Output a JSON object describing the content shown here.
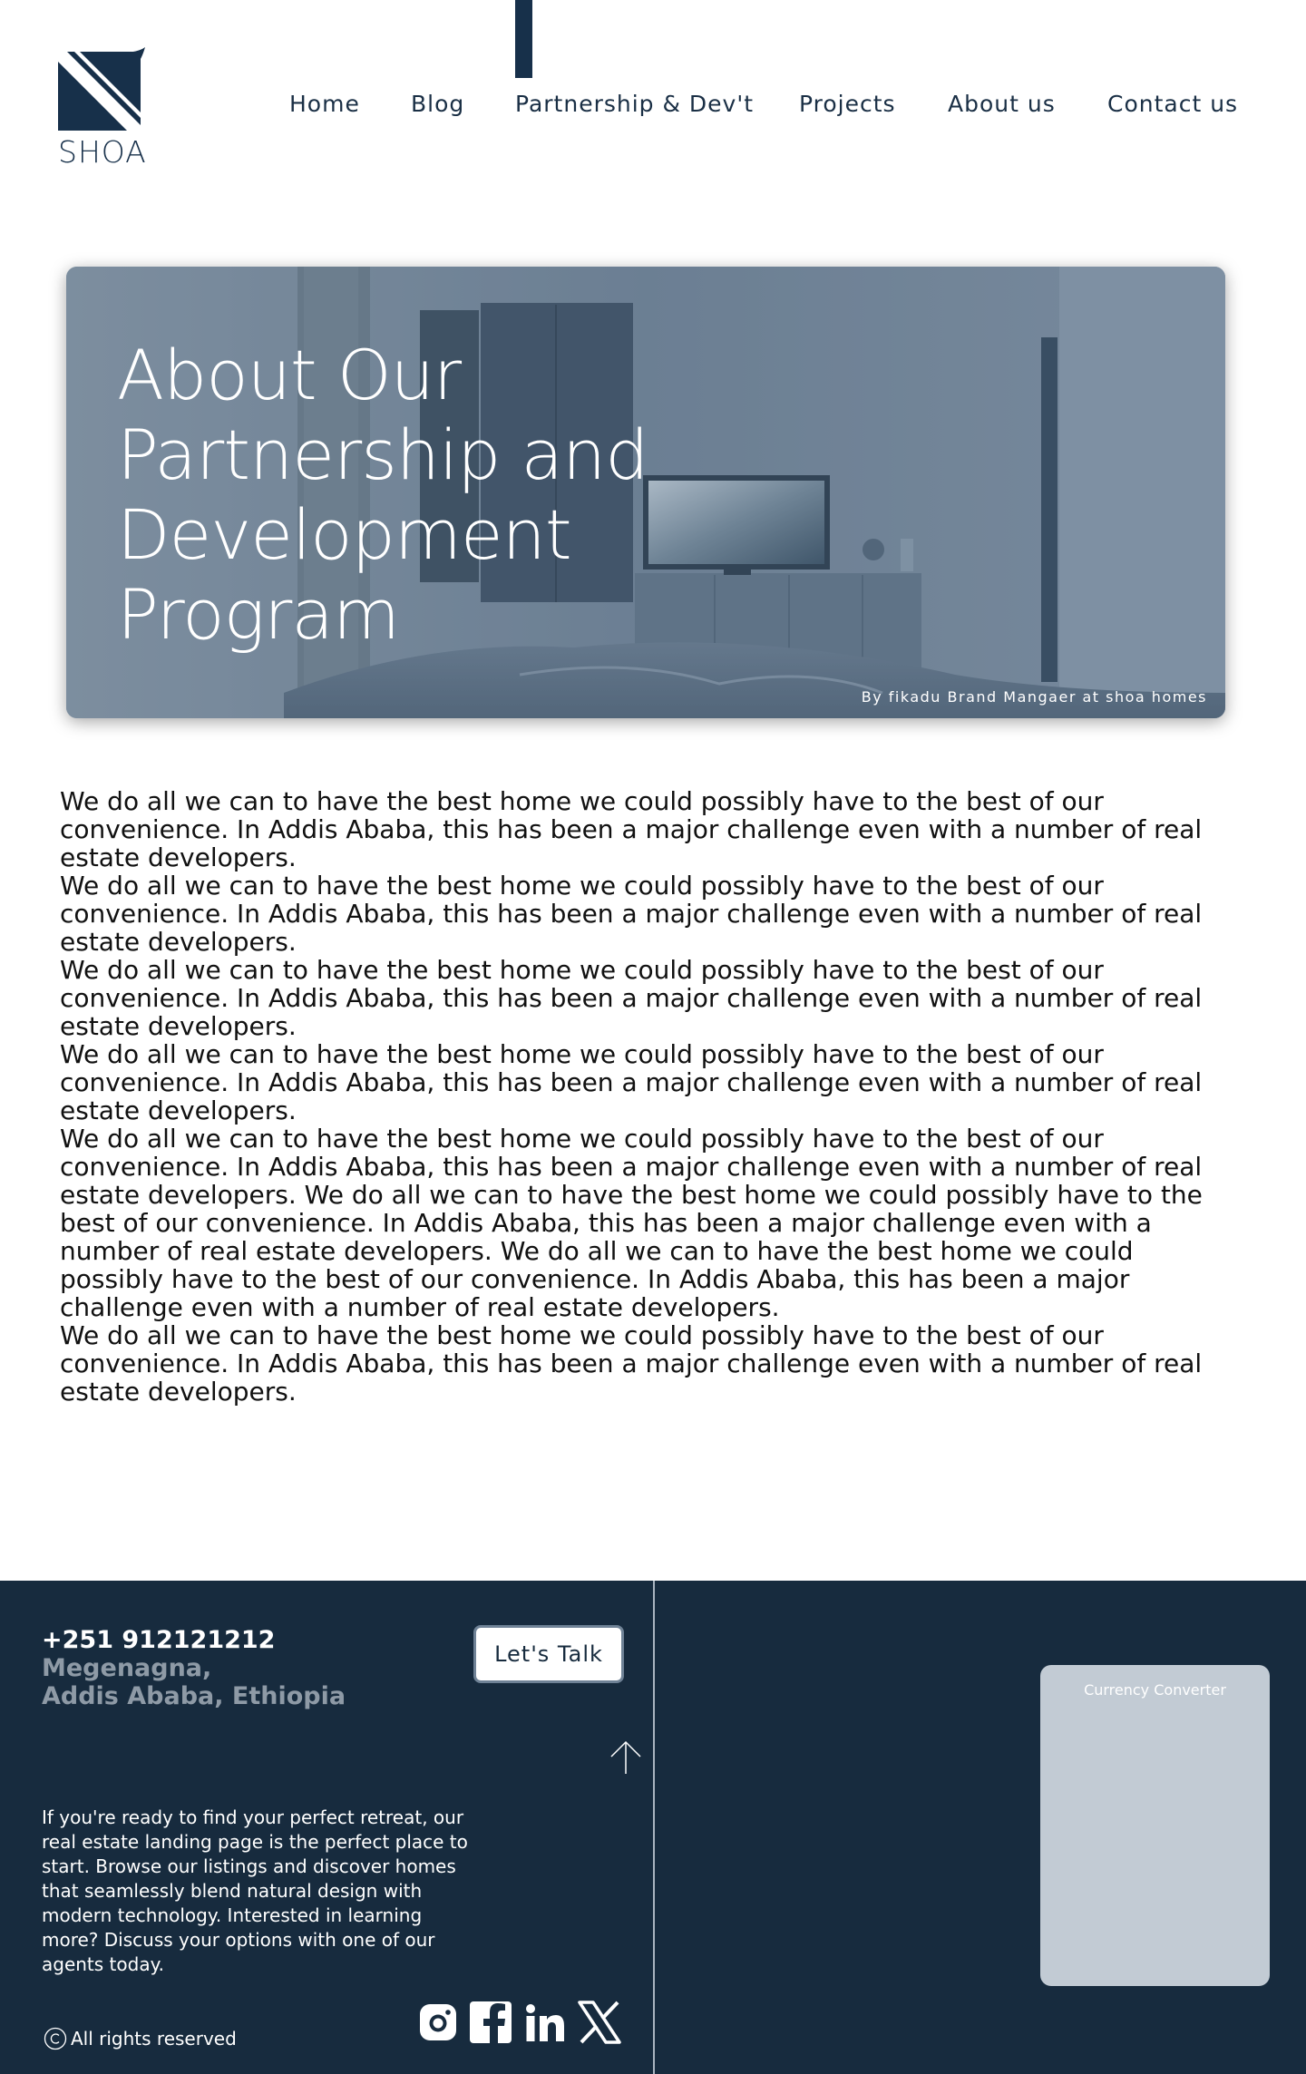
{
  "brand": {
    "logo_text": "SHOA",
    "primary_color": "#17304a",
    "footer_color": "#172b3e"
  },
  "nav": {
    "items": [
      {
        "label": "Home"
      },
      {
        "label": "Blog"
      },
      {
        "label": "Partnership & Dev't",
        "active": true
      },
      {
        "label": "Projects"
      },
      {
        "label": "About us"
      },
      {
        "label": "Contact us"
      }
    ]
  },
  "hero": {
    "title": "About Our Partnership and Development Program",
    "caption": "By fikadu Brand Mangaer at shoa homes"
  },
  "content": {
    "paragraphs": [
      "We do all we can to have the best home we could possibly have to the best of our convenience. In Addis Ababa, this has been a major challenge even with a number of real estate developers.",
      "We do all we can to have the best home we could possibly have to the best of our convenience. In Addis Ababa, this has been a major challenge even with a number of real estate developers.",
      "We do all we can to have the best home we could possibly have to the best of our convenience. In Addis Ababa, this has been a major challenge even with a number of real estate developers.",
      "We do all we can to have the best home we could possibly have to the best of our convenience. In Addis Ababa, this has been a major challenge even with a number of real estate developers.",
      "We do all we can to have the best home we could possibly have to the best of our convenience. In Addis Ababa, this has been a major challenge even with a number of real estate developers. We do all we can to have the best home we could possibly have to the best of our convenience. In Addis Ababa, this has been a major challenge even with a number of real estate developers. We do all we can to have the best home we could possibly have to the best of our convenience. In Addis Ababa, this has been a major challenge even with a number of real estate developers.",
      "We do all we can to have the best home we could possibly have to the best of our convenience. In Addis Ababa, this has been a major challenge even with a number of real estate developers."
    ]
  },
  "footer": {
    "phone": "+251 912121212",
    "address_line1": "Megenagna,",
    "address_line2": "Addis Ababa, Ethiopia",
    "talk_button": "Let's Talk",
    "description": "If you're ready to find your perfect retreat, our real estate landing page is the perfect place to start. Browse our listings and discover homes that seamlessly blend natural design with modern technology. Interested in learning more? Discuss your options with one of our agents today.",
    "rights": "All rights reserved",
    "converter_title": "Currency Converter",
    "socials": [
      "instagram-icon",
      "facebook-icon",
      "linkedin-icon",
      "x-icon"
    ]
  }
}
